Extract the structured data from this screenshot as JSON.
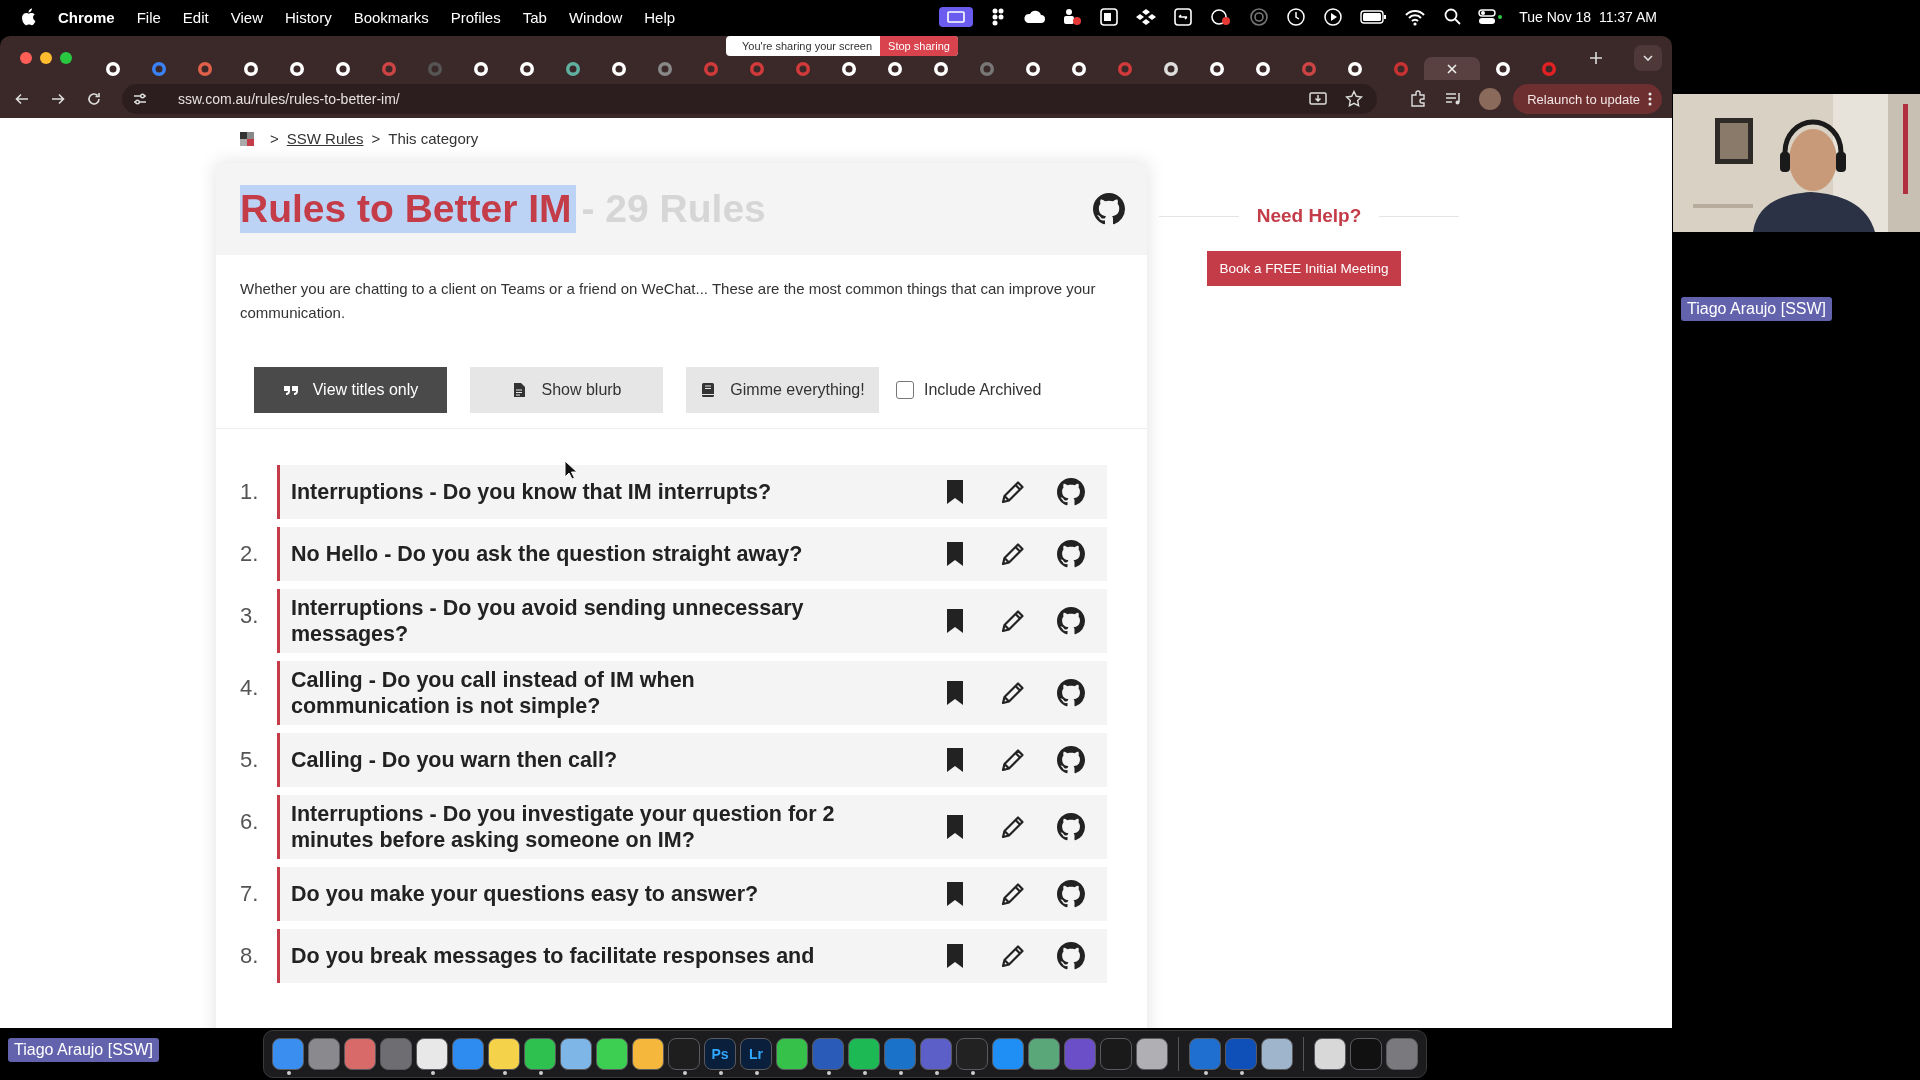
{
  "menu_bar": {
    "app": "Chrome",
    "menus": [
      "File",
      "Edit",
      "View",
      "History",
      "Bookmarks",
      "Profiles",
      "Tab",
      "Window",
      "Help"
    ],
    "clock": "Tue Nov 18  11:37 AM"
  },
  "screen_share": {
    "message": "You're sharing your screen",
    "button": "Stop sharing"
  },
  "tabs": [
    {
      "color": "#ffffff",
      "selected": false
    },
    {
      "color": "#3b82f6",
      "selected": false
    },
    {
      "color": "#e0604a",
      "selected": false
    },
    {
      "color": "#ffffff",
      "selected": false
    },
    {
      "color": "#ffffff",
      "selected": false
    },
    {
      "color": "#ffffff",
      "selected": false
    },
    {
      "color": "#cc4444",
      "selected": false
    },
    {
      "color": "#555555",
      "selected": false
    },
    {
      "color": "#ffffff",
      "selected": false
    },
    {
      "color": "#ffffff",
      "selected": false
    },
    {
      "color": "#5fb0a0",
      "selected": false
    },
    {
      "color": "#ffffff",
      "selected": false
    },
    {
      "color": "#888888",
      "selected": false
    },
    {
      "color": "#d03a3a",
      "selected": false
    },
    {
      "color": "#d03a3a",
      "selected": false
    },
    {
      "color": "#d03a3a",
      "selected": false
    },
    {
      "color": "#ffffff",
      "selected": false
    },
    {
      "color": "#ffffff",
      "selected": false
    },
    {
      "color": "#ffffff",
      "selected": false
    },
    {
      "color": "#777777",
      "selected": false
    },
    {
      "color": "#ffffff",
      "selected": false
    },
    {
      "color": "#ffffff",
      "selected": false
    },
    {
      "color": "#d03a3a",
      "selected": false
    },
    {
      "color": "#dddddd",
      "selected": false
    },
    {
      "color": "#ffffff",
      "selected": false
    },
    {
      "color": "#ffffff",
      "selected": false
    },
    {
      "color": "#cc4444",
      "selected": false
    },
    {
      "color": "#ffffff",
      "selected": false
    },
    {
      "color": "#c83232",
      "selected": false
    },
    {
      "selected": true
    },
    {
      "color": "#ffffff",
      "selected": false
    },
    {
      "color": "#e22222",
      "selected": false
    }
  ],
  "address_bar": {
    "url": "ssw.com.au/rules/rules-to-better-im/",
    "relaunch_button": "Relaunch to update"
  },
  "breadcrumb": [
    {
      "separator": ">",
      "label": "SSW Rules",
      "link": true
    },
    {
      "separator": ">",
      "label": "This category",
      "link": false
    }
  ],
  "category": {
    "title": "Rules to Better IM",
    "highlighted": true,
    "count": "- 29 Rules",
    "description": "Whether you are chatting to a client on Teams or a friend on WeChat... These are the most common things that can improve your communication."
  },
  "view_modes": [
    {
      "label": "View titles only",
      "selected": true
    },
    {
      "label": "Show blurb",
      "selected": false
    },
    {
      "label": "Gimme everything!",
      "selected": false
    }
  ],
  "archived_checkbox": {
    "label": "Include Archived",
    "checked": false
  },
  "rules": [
    {
      "number": "1.",
      "title": "Interruptions - Do you know that IM interrupts?"
    },
    {
      "number": "2.",
      "title": "No Hello - Do you ask the question straight away?"
    },
    {
      "number": "3.",
      "title": "Interruptions - Do you avoid sending unnecessary messages?"
    },
    {
      "number": "4.",
      "title": "Calling - Do you call instead of IM when communication is not simple?"
    },
    {
      "number": "5.",
      "title": "Calling - Do you warn then call?"
    },
    {
      "number": "6.",
      "title": "Interruptions - Do you investigate your question for 2 minutes before asking someone on IM?"
    },
    {
      "number": "7.",
      "title": "Do you make your questions easy to answer?"
    },
    {
      "number": "8.",
      "title": "Do you break messages to facilitate responses and"
    }
  ],
  "sidebar": {
    "heading": "Need Help?",
    "button": "Book a FREE Initial Meeting"
  },
  "video_call": {
    "name_tag": "Tiago Araujo [SSW]"
  },
  "bottom_name_tag": "Tiago Araujo [SSW]",
  "dock": [
    {
      "kind": "app",
      "color": "#3a8ef0",
      "running": true
    },
    {
      "kind": "app",
      "color": "#8a8a8e",
      "running": false
    },
    {
      "kind": "app",
      "color": "#d86a6a",
      "running": false
    },
    {
      "kind": "app",
      "color": "#6e6e72",
      "running": false
    },
    {
      "kind": "app",
      "color": "#e8e8e8",
      "running": true
    },
    {
      "kind": "app",
      "color": "#2e8cf0",
      "running": false
    },
    {
      "kind": "app",
      "color": "#f4d34a",
      "running": true
    },
    {
      "kind": "app",
      "color": "#2fc14f",
      "running": true
    },
    {
      "kind": "app",
      "color": "#7fb6e8",
      "running": false
    },
    {
      "kind": "app",
      "color": "#3ccf52",
      "running": false
    },
    {
      "kind": "app",
      "color": "#f5b83d",
      "running": false
    },
    {
      "kind": "app",
      "color": "#1e1e1e",
      "running": true
    },
    {
      "kind": "app",
      "color": "#0a1f3b",
      "label": "Ps",
      "running": true
    },
    {
      "kind": "app",
      "color": "#0a1f3b",
      "label": "Lr",
      "running": true
    },
    {
      "kind": "app",
      "color": "#36c24a",
      "running": false
    },
    {
      "kind": "app",
      "color": "#2b5bb8",
      "running": true
    },
    {
      "kind": "app",
      "color": "#1db954",
      "running": true
    },
    {
      "kind": "app",
      "color": "#1a73c8",
      "running": true
    },
    {
      "kind": "app",
      "color": "#5b5fc7",
      "running": true
    },
    {
      "kind": "app",
      "color": "#222222",
      "running": true
    },
    {
      "kind": "app",
      "color": "#1f8ef5",
      "running": false
    },
    {
      "kind": "app",
      "color": "#5aa77a",
      "running": false
    },
    {
      "kind": "app",
      "color": "#6a4fc8",
      "running": false
    },
    {
      "kind": "app",
      "color": "#1a1a1a",
      "running": false
    },
    {
      "kind": "app",
      "color": "#b0b0b4",
      "running": false
    },
    {
      "kind": "separator"
    },
    {
      "kind": "app",
      "color": "#1e6fd0",
      "running": true
    },
    {
      "kind": "app",
      "color": "#0e4fb8",
      "running": true
    },
    {
      "kind": "app",
      "color": "#9fb5cc",
      "running": false
    },
    {
      "kind": "separator"
    },
    {
      "kind": "app",
      "color": "#d8d8d8",
      "running": false
    },
    {
      "kind": "app",
      "color": "#111111",
      "running": false
    },
    {
      "kind": "app",
      "color": "#7a7a7e",
      "running": false
    }
  ]
}
